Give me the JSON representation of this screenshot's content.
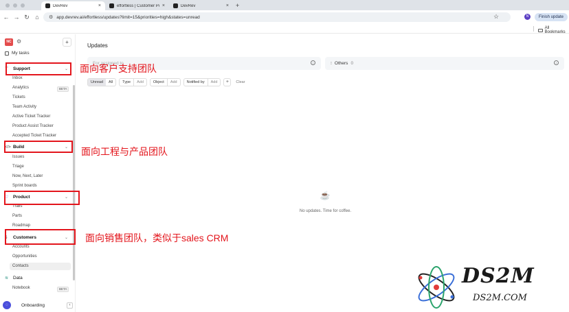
{
  "browser": {
    "tabs": [
      {
        "label": "DevRev",
        "active": true
      },
      {
        "label": "effortless | Customer Portal",
        "active": false
      },
      {
        "label": "DevRev",
        "active": false
      }
    ],
    "tab_close": "×",
    "new_tab": "+",
    "url": "app.devrev.ai/effortless/updates?limit=15&priorities=high&states=unread",
    "profile_initial": "N",
    "finish_update": "Finish update",
    "bookmarks": "All Bookmarks"
  },
  "sidebar": {
    "workspace_initials": "NC",
    "plus": "+",
    "my_tasks": "My tasks",
    "sections": [
      {
        "label": "Support",
        "icon": "ticket-icon",
        "items": [
          "Inbox",
          "Analytics",
          "Tickets",
          "Team Activity",
          "Active Ticket Tracker",
          "Product Assist Tracker",
          "Accepted Ticket Tracker"
        ],
        "beta_item": "Analytics"
      },
      {
        "label": "Build",
        "icon": "code-icon",
        "items": [
          "Issues",
          "Triage",
          "Now, Next, Later",
          "Sprint boards"
        ]
      },
      {
        "label": "Product",
        "icon": "heart-icon",
        "items": [
          "Trails",
          "Parts",
          "Roadmap"
        ]
      },
      {
        "label": "Customers",
        "icon": "dollar-icon",
        "items": [
          "Accounts",
          "Opportunities",
          "Contacts"
        ]
      },
      {
        "label": "Data",
        "icon": "layers-icon",
        "items": [
          "Notebook"
        ],
        "beta_item": "Notebook"
      }
    ],
    "beta_label": "BETA",
    "onboarding": "Onboarding",
    "onboarding_btn": "‹"
  },
  "main": {
    "title": "Updates",
    "cards": [
      {
        "label": "For assigned to",
        "count": ""
      },
      {
        "label": "Others",
        "count": "0"
      }
    ],
    "filters": {
      "state": [
        "Unread",
        "All"
      ],
      "type": [
        "Type",
        "Add"
      ],
      "object": [
        "Object",
        "Add"
      ],
      "notified": [
        "Notified by",
        "Add"
      ],
      "plus": "+",
      "clear": "Clear"
    },
    "empty_message": "No updates. Time for coffee."
  },
  "annotations": {
    "support": "面向客户支持团队",
    "build": "面向工程与产品团队",
    "customers": "面向销售团队，类似于sales CRM"
  },
  "watermark": {
    "big": "DS2M",
    "small": "DS2M.COM"
  },
  "colors": {
    "annotation_red": "#e3141b",
    "workspace_badge": "#e34b4b",
    "onboarding_accent": "#4a4fdc"
  }
}
